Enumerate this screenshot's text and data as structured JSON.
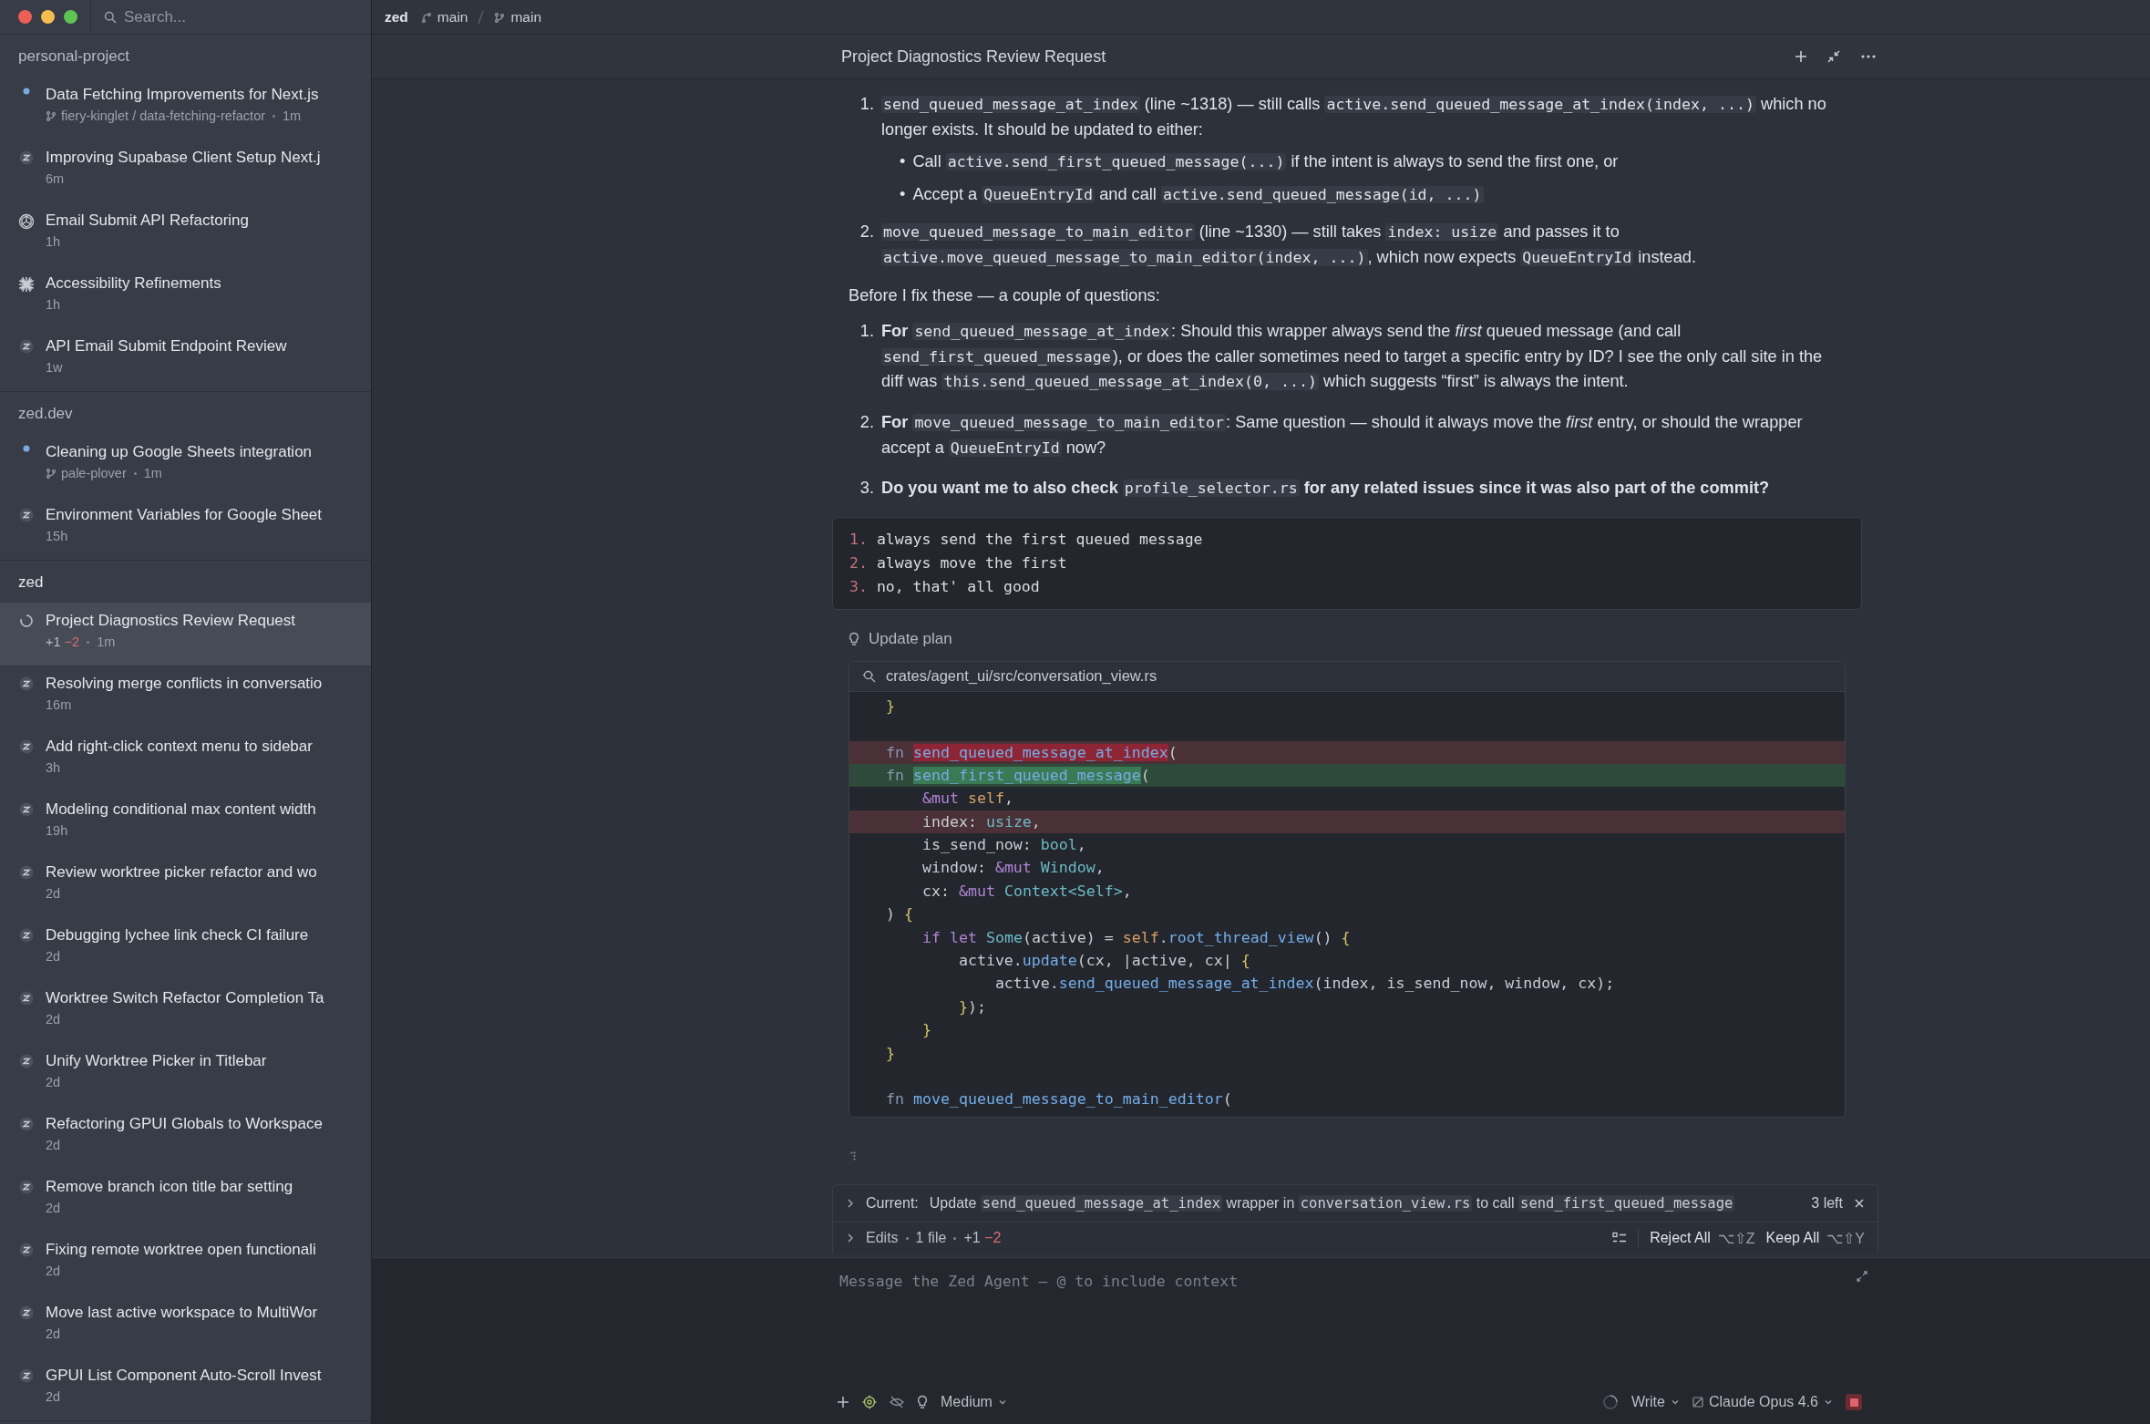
{
  "sidebar": {
    "search": {
      "placeholder": "Search..."
    },
    "groups": [
      {
        "name": "personal-project",
        "threads": [
          {
            "title": "Data Fetching Improvements for Next.js",
            "kind": "dot",
            "selected": false,
            "branch": "fiery-kinglet / data-fetching-refactor",
            "time": "1m"
          },
          {
            "title": "Improving Supabase Client Setup Next.j",
            "kind": "zed",
            "selected": false,
            "time": "6m"
          },
          {
            "title": "Email Submit API Refactoring",
            "kind": "openai",
            "selected": false,
            "time": "1h"
          },
          {
            "title": "Accessibility Refinements",
            "kind": "claude",
            "selected": false,
            "time": "1h"
          },
          {
            "title": "API Email Submit Endpoint Review",
            "kind": "zed",
            "selected": false,
            "time": "1w"
          }
        ]
      },
      {
        "name": "zed.dev",
        "threads": [
          {
            "title": "Cleaning up Google Sheets integration",
            "kind": "dot",
            "selected": false,
            "branch": "pale-plover",
            "time": "1m"
          },
          {
            "title": "Environment Variables for Google Sheet",
            "kind": "zed",
            "selected": false,
            "time": "15h"
          }
        ]
      },
      {
        "name": "zed",
        "threads": [
          {
            "title": "Project Diagnostics Review Request",
            "kind": "loading",
            "selected": true,
            "added": "+1",
            "removed": "−2",
            "time": "1m"
          },
          {
            "title": "Resolving merge conflicts in conversatio",
            "kind": "zed",
            "selected": false,
            "time": "16m"
          },
          {
            "title": "Add right-click context menu to sidebar",
            "kind": "zed",
            "selected": false,
            "time": "3h"
          },
          {
            "title": "Modeling conditional max content width",
            "kind": "zed",
            "selected": false,
            "time": "19h"
          },
          {
            "title": "Review worktree picker refactor and wo",
            "kind": "zed",
            "selected": false,
            "time": "2d"
          },
          {
            "title": "Debugging lychee link check CI failure",
            "kind": "zed",
            "selected": false,
            "time": "2d"
          },
          {
            "title": "Worktree Switch Refactor Completion Ta",
            "kind": "zed",
            "selected": false,
            "time": "2d"
          },
          {
            "title": "Unify Worktree Picker in Titlebar",
            "kind": "zed",
            "selected": false,
            "time": "2d"
          },
          {
            "title": "Refactoring GPUI Globals to Workspace",
            "kind": "zed",
            "selected": false,
            "time": "2d"
          },
          {
            "title": "Remove branch icon title bar setting",
            "kind": "zed",
            "selected": false,
            "time": "2d"
          },
          {
            "title": "Fixing remote worktree open functionali",
            "kind": "zed",
            "selected": false,
            "time": "2d"
          },
          {
            "title": "Move last active workspace to MultiWor",
            "kind": "zed",
            "selected": false,
            "time": "2d"
          },
          {
            "title": "GPUI List Component Auto-Scroll Invest",
            "kind": "zed",
            "selected": false,
            "time": "2d"
          }
        ]
      }
    ]
  },
  "toolbar": {
    "project": "zed",
    "branches": [
      {
        "kind": "worktree",
        "name": "main"
      },
      {
        "kind": "branch",
        "name": "main"
      }
    ]
  },
  "thread": {
    "title": "Project Diagnostics Review Request",
    "response": [
      {
        "kind": "list",
        "items": [
          {
            "number": "1.",
            "text": "send_queued_message_at_index (line ~1318) — still calls active.send_queued_message_at_index(index, ...) which no longer exists. It should be updated to either:",
            "bullets": [
              {
                "bullet": "•",
                "text": "Call active.send_first_queued_message(...) if the intent is always to send the first one, or"
              },
              {
                "bullet": "•",
                "text": "Accept a QueueEntryId and call active.send_queued_message(id, ...)"
              }
            ]
          },
          {
            "number": "2.",
            "text": "move_queued_message_to_main_editor (line ~1330) — still takes index: usize and passes it to active.move_queued_message_to_main_editor(index, ...), which now expects QueueEntryId instead."
          }
        ]
      },
      {
        "kind": "paragraph",
        "text": "Before I fix these — a couple of questions:"
      },
      {
        "kind": "list",
        "items": [
          {
            "number": "1.",
            "text": "**For** send_queued_message_at_index: Should this wrapper always send the *first* queued message (and call send_first_queued_message), or does the caller sometimes need to target a specific entry by ID? I see the only call site in the diff was this.send_queued_message_at_index(0, ...) which suggests “first” is always the intent."
          },
          {
            "number": "2.",
            "text": "**For** move_queued_message_to_main_editor: Same question — should it always move the *first* entry, or should the wrapper accept a QueueEntryId now?"
          },
          {
            "number": "3.",
            "text": "**Do you want me to also check** profile_selector.rs **for any related issues since it was also part of the commit?**"
          }
        ]
      }
    ],
    "user_message": [
      {
        "number": "1.",
        "text": "always send the first queued message"
      },
      {
        "number": "2.",
        "text": "always move the first"
      },
      {
        "number": "3.",
        "text": "no, that' all good"
      }
    ],
    "tool_call": {
      "label": "Update plan",
      "path": "crates/agent_ui/src/conversation_view.rs",
      "lines": [
        {
          "removed": false,
          "added": false,
          "text": "}"
        },
        {
          "removed": false,
          "added": false
        },
        {
          "removed": true,
          "added": false,
          "text": "fn send_queued_message_at_index("
        },
        {
          "removed": false,
          "added": true,
          "text": "fn send_first_queued_message("
        },
        {
          "removed": false,
          "added": false,
          "text": "    &mut self,"
        },
        {
          "removed": true,
          "added": false,
          "text": "    index: usize,"
        },
        {
          "removed": false,
          "added": false,
          "text": "    is_send_now: bool,"
        },
        {
          "removed": false,
          "added": false,
          "text": "    window: &mut Window,"
        },
        {
          "removed": false,
          "added": false,
          "text": "    cx: &mut Context<Self>,"
        },
        {
          "removed": false,
          "added": false,
          "text": ") {"
        },
        {
          "removed": false,
          "added": false,
          "text": "    if let Some(active) = self.root_thread_view() {"
        },
        {
          "removed": false,
          "added": false,
          "text": "        active.update(cx, |active, cx| {"
        },
        {
          "removed": false,
          "added": false,
          "text": "            active.send_queued_message_at_index(index, is_send_now, window, cx);"
        },
        {
          "removed": false,
          "added": false,
          "text": "        });"
        },
        {
          "removed": false,
          "added": false,
          "text": "    }"
        },
        {
          "removed": false,
          "added": false,
          "text": "}"
        },
        {
          "removed": false,
          "added": false
        },
        {
          "removed": false,
          "added": false,
          "text": "fn move_queued_message_to_main_editor("
        }
      ]
    },
    "plan": {
      "label": "Current:",
      "text": "Update send_queued_message_at_index wrapper in conversation_view.rs to call send_first_queued_message",
      "remaining": "3 left"
    },
    "edits": {
      "label": "Edits",
      "files": "1 file",
      "added": "+1",
      "removed": "−2",
      "actions": [
        {
          "label": "Reject All",
          "shortcut": "⌥⇧Z"
        },
        {
          "label": "Keep All",
          "shortcut": "⌥⇧Y"
        }
      ]
    },
    "composer": {
      "placeholder": "Message the Zed Agent — @ to include context",
      "effort": "Medium",
      "mode": "Write",
      "model": "Claude Opus 4.6"
    }
  }
}
